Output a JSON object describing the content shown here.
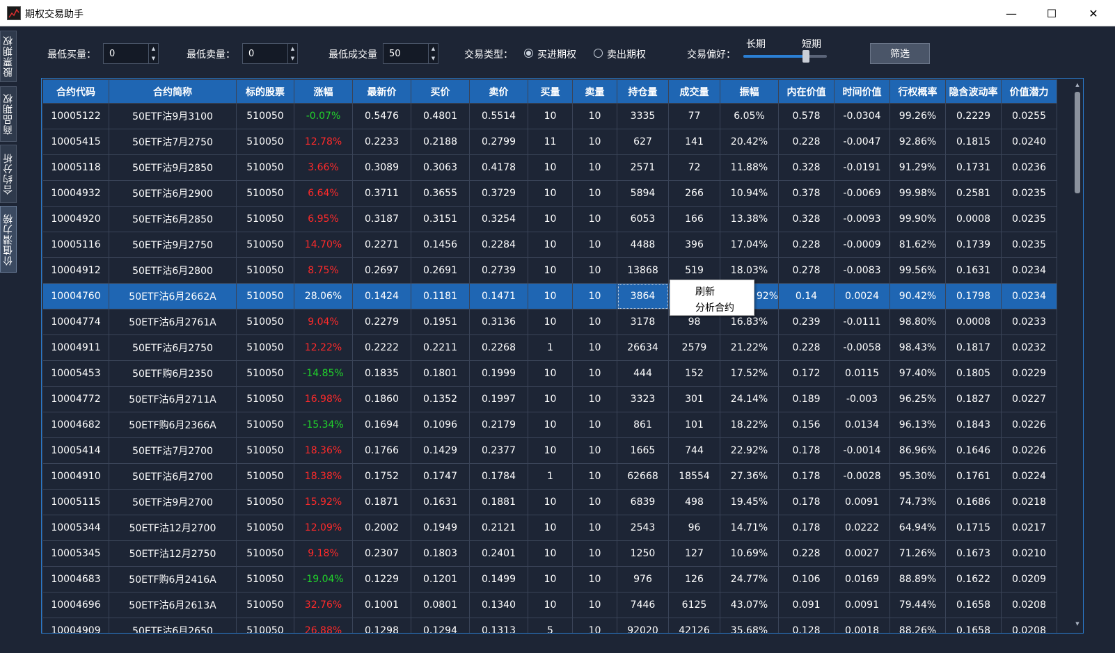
{
  "window": {
    "title": "期权交易助手",
    "minimize_glyph": "—",
    "maximize_glyph": "☐",
    "close_glyph": "✕"
  },
  "side_tabs": [
    {
      "label": "股票期权"
    },
    {
      "label": "商品期权"
    },
    {
      "label": "合约分析"
    },
    {
      "label": "价值潜力榜"
    }
  ],
  "filters": {
    "min_buy_label": "最低买量：",
    "min_buy_value": "0",
    "min_sell_label": "最低卖量：",
    "min_sell_value": "0",
    "min_volume_label": "最低成交量",
    "min_volume_value": "50",
    "trade_type_label": "交易类型：",
    "trade_type_options": [
      "买进期权",
      "卖出期权"
    ],
    "trade_type_selected": "买进期权",
    "preference_label": "交易偏好：",
    "preference_long": "长期",
    "preference_short": "短期",
    "preference_level_pct": 75,
    "filter_button": "筛选"
  },
  "table": {
    "columns": [
      "合约代码",
      "合约简称",
      "标的股票",
      "涨幅",
      "最新价",
      "买价",
      "卖价",
      "买量",
      "卖量",
      "持仓量",
      "成交量",
      "振幅",
      "内在价值",
      "时间价值",
      "行权概率",
      "隐含波动率",
      "价值潜力"
    ],
    "rows": [
      [
        "10005122",
        "50ETF沽9月3100",
        "510050",
        "-0.07%",
        "0.5476",
        "0.4801",
        "0.5514",
        "10",
        "10",
        "3335",
        "77",
        "6.05%",
        "0.578",
        "-0.0304",
        "99.26%",
        "0.2229",
        "0.0255"
      ],
      [
        "10005415",
        "50ETF沽7月2750",
        "510050",
        "12.78%",
        "0.2233",
        "0.2188",
        "0.2799",
        "11",
        "10",
        "627",
        "141",
        "20.42%",
        "0.228",
        "-0.0047",
        "92.86%",
        "0.1815",
        "0.0240"
      ],
      [
        "10005118",
        "50ETF沽9月2850",
        "510050",
        "3.66%",
        "0.3089",
        "0.3063",
        "0.4178",
        "10",
        "10",
        "2571",
        "72",
        "11.88%",
        "0.328",
        "-0.0191",
        "91.29%",
        "0.1731",
        "0.0236"
      ],
      [
        "10004932",
        "50ETF沽6月2900",
        "510050",
        "6.64%",
        "0.3711",
        "0.3655",
        "0.3729",
        "10",
        "10",
        "5894",
        "266",
        "10.94%",
        "0.378",
        "-0.0069",
        "99.98%",
        "0.2581",
        "0.0235"
      ],
      [
        "10004920",
        "50ETF沽6月2850",
        "510050",
        "6.95%",
        "0.3187",
        "0.3151",
        "0.3254",
        "10",
        "10",
        "6053",
        "166",
        "13.38%",
        "0.328",
        "-0.0093",
        "99.90%",
        "0.0008",
        "0.0235"
      ],
      [
        "10005116",
        "50ETF沽9月2750",
        "510050",
        "14.70%",
        "0.2271",
        "0.1456",
        "0.2284",
        "10",
        "10",
        "4488",
        "396",
        "17.04%",
        "0.228",
        "-0.0009",
        "81.62%",
        "0.1739",
        "0.0235"
      ],
      [
        "10004912",
        "50ETF沽6月2800",
        "510050",
        "8.75%",
        "0.2697",
        "0.2691",
        "0.2739",
        "10",
        "10",
        "13868",
        "519",
        "18.03%",
        "0.278",
        "-0.0083",
        "99.56%",
        "0.1631",
        "0.0234"
      ],
      [
        "10004760",
        "50ETF沽6月2662A",
        "510050",
        "28.06%",
        "0.1424",
        "0.1181",
        "0.1471",
        "10",
        "10",
        "3864",
        "",
        "92%",
        "0.14",
        "0.0024",
        "90.42%",
        "0.1798",
        "0.0234"
      ],
      [
        "10004774",
        "50ETF沽6月2761A",
        "510050",
        "9.04%",
        "0.2279",
        "0.1951",
        "0.3136",
        "10",
        "10",
        "3178",
        "98",
        "16.83%",
        "0.239",
        "-0.0111",
        "98.80%",
        "0.0008",
        "0.0233"
      ],
      [
        "10004911",
        "50ETF沽6月2750",
        "510050",
        "12.22%",
        "0.2222",
        "0.2211",
        "0.2268",
        "1",
        "10",
        "26634",
        "2579",
        "21.22%",
        "0.228",
        "-0.0058",
        "98.43%",
        "0.1817",
        "0.0232"
      ],
      [
        "10005453",
        "50ETF购6月2350",
        "510050",
        "-14.85%",
        "0.1835",
        "0.1801",
        "0.1999",
        "10",
        "10",
        "444",
        "152",
        "17.52%",
        "0.172",
        "0.0115",
        "97.40%",
        "0.1805",
        "0.0229"
      ],
      [
        "10004772",
        "50ETF沽6月2711A",
        "510050",
        "16.98%",
        "0.1860",
        "0.1352",
        "0.1997",
        "10",
        "10",
        "3323",
        "301",
        "24.14%",
        "0.189",
        "-0.003",
        "96.25%",
        "0.1827",
        "0.0227"
      ],
      [
        "10004682",
        "50ETF购6月2366A",
        "510050",
        "-15.34%",
        "0.1694",
        "0.1096",
        "0.2179",
        "10",
        "10",
        "861",
        "101",
        "18.22%",
        "0.156",
        "0.0134",
        "96.13%",
        "0.1843",
        "0.0226"
      ],
      [
        "10005414",
        "50ETF沽7月2700",
        "510050",
        "18.36%",
        "0.1766",
        "0.1429",
        "0.2377",
        "10",
        "10",
        "1665",
        "744",
        "22.92%",
        "0.178",
        "-0.0014",
        "86.96%",
        "0.1646",
        "0.0226"
      ],
      [
        "10004910",
        "50ETF沽6月2700",
        "510050",
        "18.38%",
        "0.1752",
        "0.1747",
        "0.1784",
        "1",
        "10",
        "62668",
        "18554",
        "27.36%",
        "0.178",
        "-0.0028",
        "95.30%",
        "0.1761",
        "0.0224"
      ],
      [
        "10005115",
        "50ETF沽9月2700",
        "510050",
        "15.92%",
        "0.1871",
        "0.1631",
        "0.1881",
        "10",
        "10",
        "6839",
        "498",
        "19.45%",
        "0.178",
        "0.0091",
        "74.73%",
        "0.1686",
        "0.0218"
      ],
      [
        "10005344",
        "50ETF沽12月2700",
        "510050",
        "12.09%",
        "0.2002",
        "0.1949",
        "0.2121",
        "10",
        "10",
        "2543",
        "96",
        "14.71%",
        "0.178",
        "0.0222",
        "64.94%",
        "0.1715",
        "0.0217"
      ],
      [
        "10005345",
        "50ETF沽12月2750",
        "510050",
        "9.18%",
        "0.2307",
        "0.1803",
        "0.2401",
        "10",
        "10",
        "1250",
        "127",
        "10.69%",
        "0.228",
        "0.0027",
        "71.26%",
        "0.1673",
        "0.0210"
      ],
      [
        "10004683",
        "50ETF购6月2416A",
        "510050",
        "-19.04%",
        "0.1229",
        "0.1201",
        "0.1499",
        "10",
        "10",
        "976",
        "126",
        "24.77%",
        "0.106",
        "0.0169",
        "88.89%",
        "0.1622",
        "0.0209"
      ],
      [
        "10004696",
        "50ETF沽6月2613A",
        "510050",
        "32.76%",
        "0.1001",
        "0.0801",
        "0.1340",
        "10",
        "10",
        "7446",
        "6125",
        "43.07%",
        "0.091",
        "0.0091",
        "79.44%",
        "0.1658",
        "0.0208"
      ],
      [
        "10004909",
        "50ETF沽6月2650",
        "510050",
        "26.88%",
        "0.1298",
        "0.1294",
        "0.1313",
        "5",
        "10",
        "92020",
        "42126",
        "35.68%",
        "0.128",
        "0.0018",
        "88.26%",
        "0.1658",
        "0.0208"
      ]
    ],
    "selected_row": 7
  },
  "context_menu": {
    "items": [
      "刷新",
      "分析合约"
    ]
  },
  "colors": {
    "background": "#1d2535",
    "header": "#1f66b3",
    "selection": "#1f66b3",
    "rise": "#ff2a2a",
    "fall": "#21d42b",
    "border": "#2b7fd4"
  }
}
